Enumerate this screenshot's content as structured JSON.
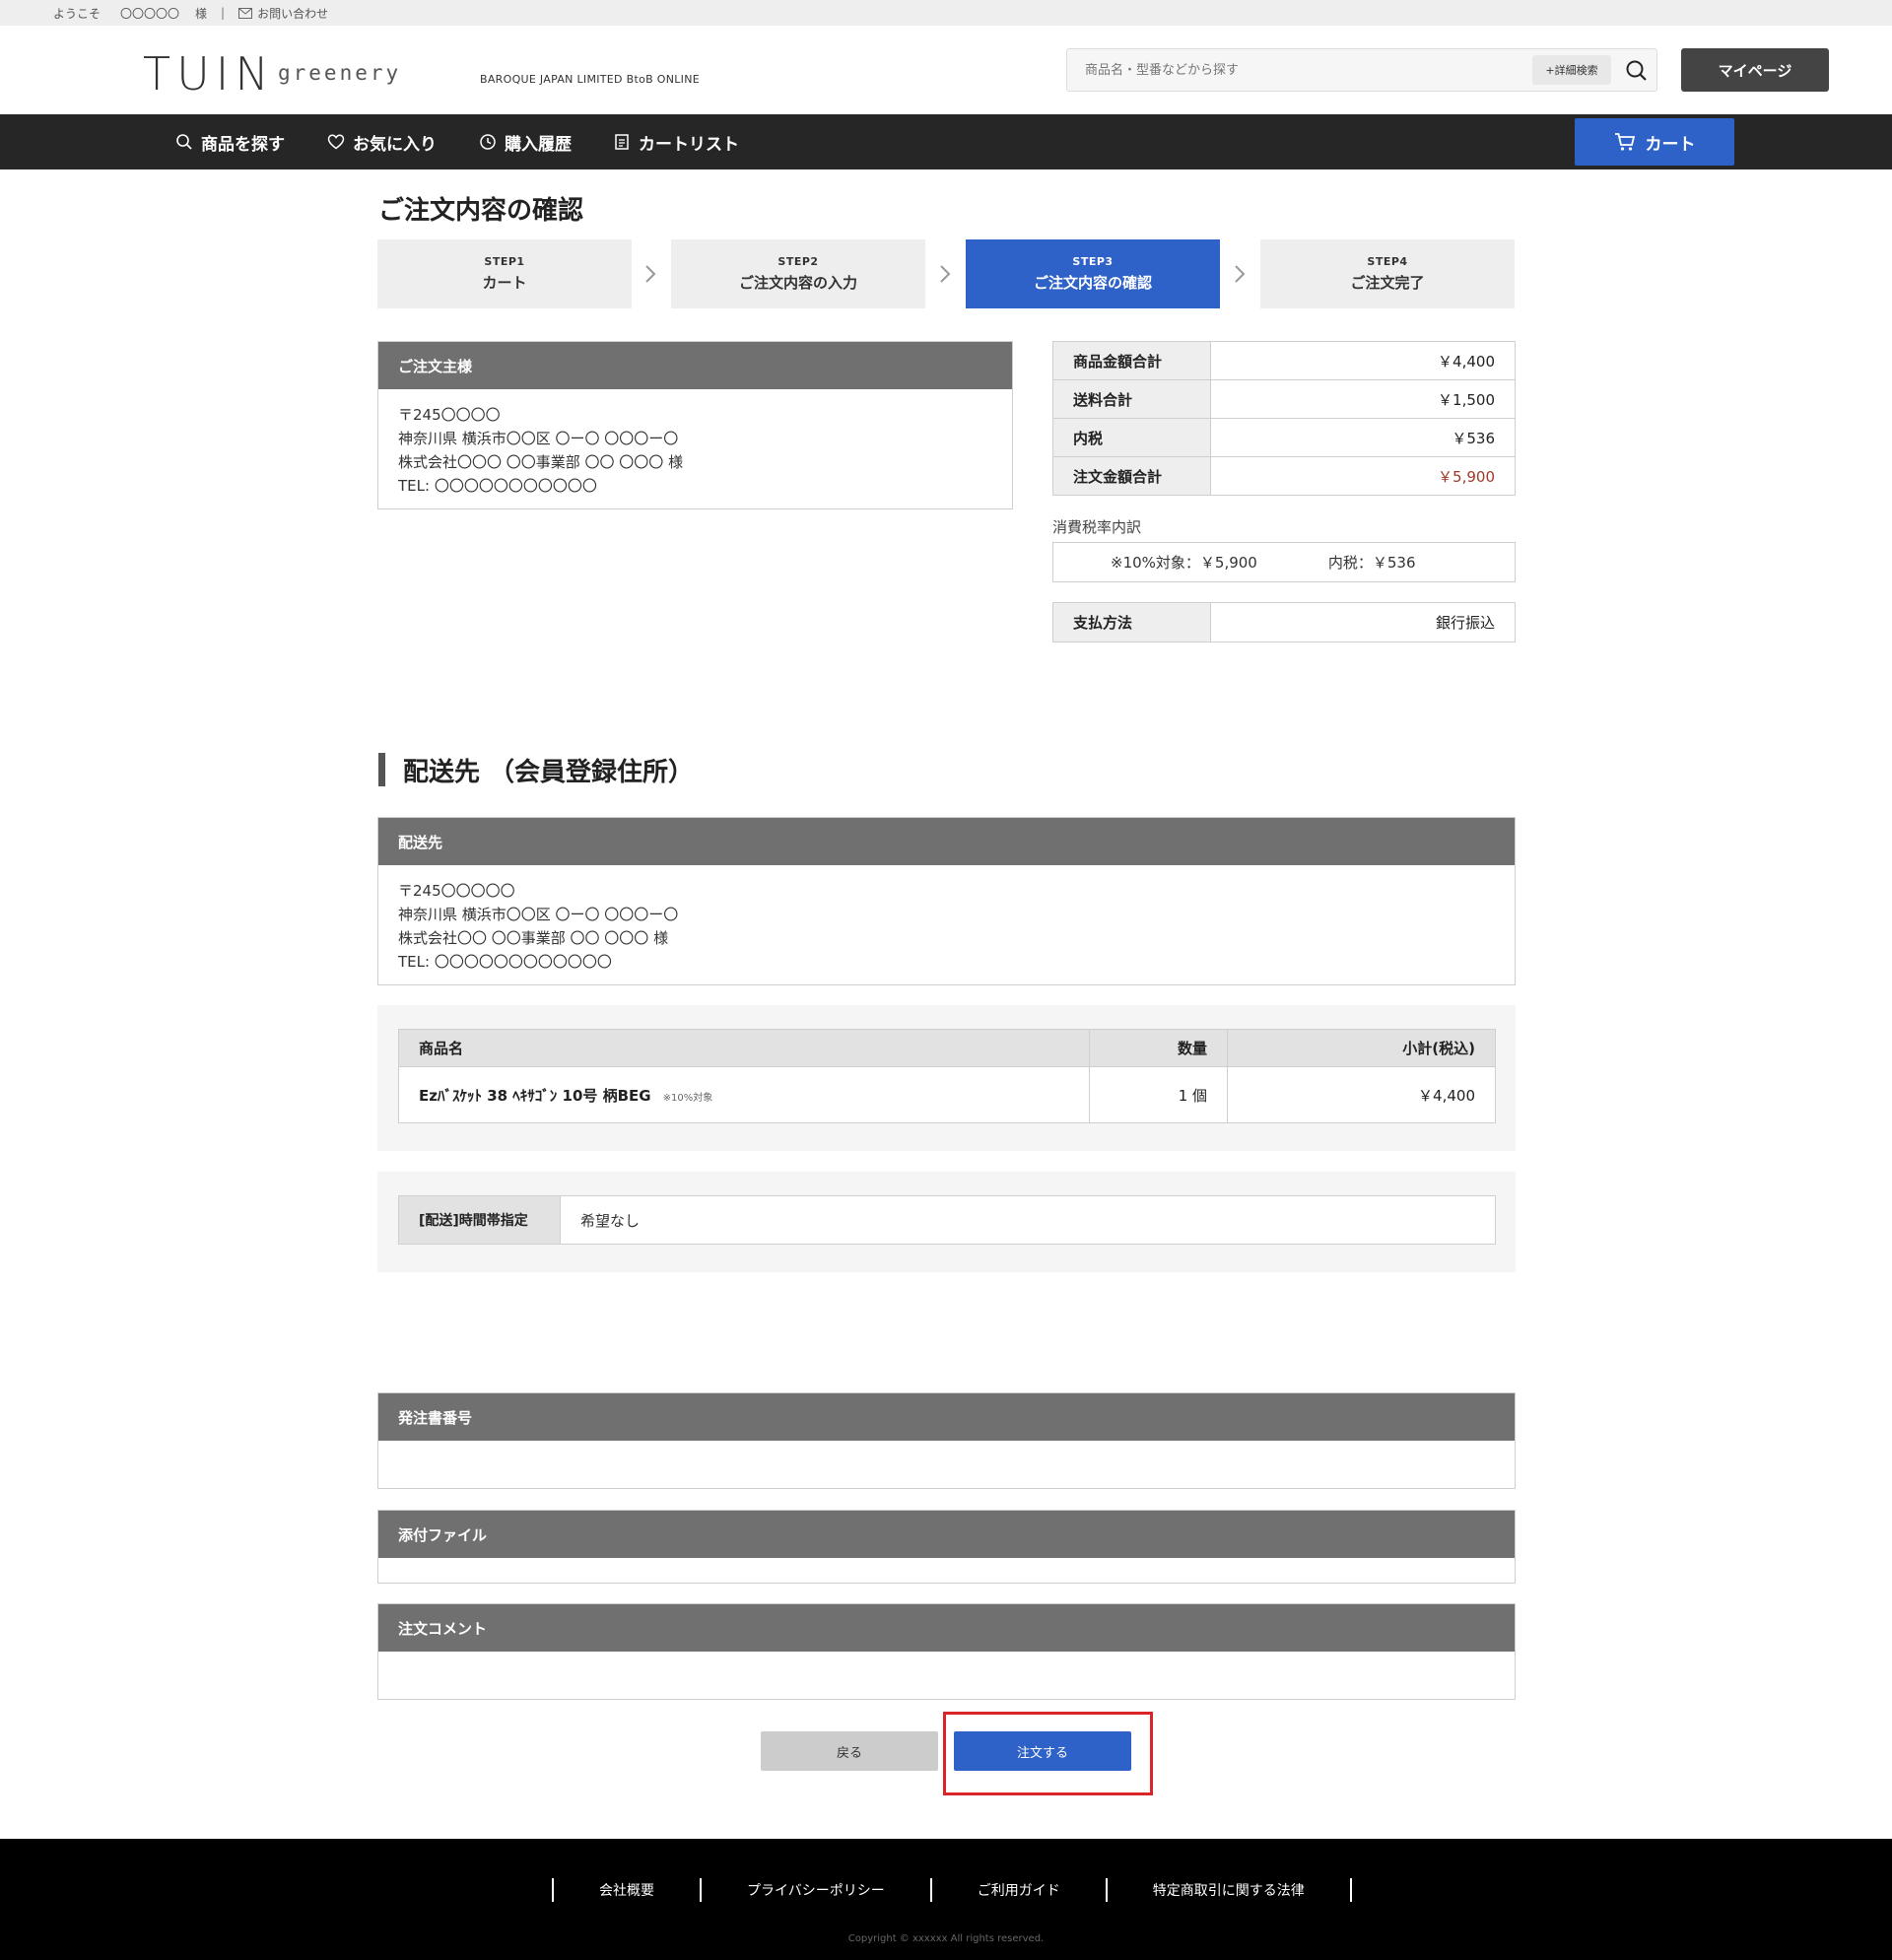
{
  "util": {
    "welcome": "ようこそ",
    "user": "〇〇〇〇〇",
    "honorific": "様",
    "separator": "|",
    "contact": "お問い合わせ"
  },
  "header": {
    "logo_main": "TUIN",
    "logo_sub": "greenery",
    "tagline": "BAROQUE JAPAN LIMITED BtoB ONLINE",
    "search_placeholder": "商品名・型番などから探す",
    "advanced_search": "+詳細検索",
    "mypage": "マイページ"
  },
  "nav": {
    "items": [
      {
        "label": "商品を探す",
        "icon": "search-icon"
      },
      {
        "label": "お気に入り",
        "icon": "heart-icon"
      },
      {
        "label": "購入履歴",
        "icon": "history-icon"
      },
      {
        "label": "カートリスト",
        "icon": "list-icon"
      }
    ],
    "cart": "カート"
  },
  "page": {
    "title": "ご注文内容の確認"
  },
  "steps": [
    {
      "num": "STEP1",
      "label": "カート",
      "active": false
    },
    {
      "num": "STEP2",
      "label": "ご注文内容の入力",
      "active": false
    },
    {
      "num": "STEP3",
      "label": "ご注文内容の確認",
      "active": true
    },
    {
      "num": "STEP4",
      "label": "ご注文完了",
      "active": false
    }
  ],
  "orderer": {
    "heading": "ご注文主様",
    "lines": [
      "〒245〇〇〇〇",
      "神奈川県 横浜市〇〇区 〇ー〇 〇〇〇ー〇",
      "株式会社〇〇〇 〇〇事業部 〇〇 〇〇〇  様",
      "TEL: 〇〇〇〇〇〇〇〇〇〇〇"
    ]
  },
  "summary": {
    "rows": [
      {
        "label": "商品金額合計",
        "value": "￥4,400"
      },
      {
        "label": "送料合計",
        "value": "￥1,500"
      },
      {
        "label": "内税",
        "value": "￥536"
      },
      {
        "label": "注文金額合計",
        "value": "￥5,900"
      }
    ],
    "tax_breakdown_label": "消費税率内訳",
    "tax_target": "※10%対象：￥5,900",
    "tax_included": "内税：￥536",
    "payment_label": "支払方法",
    "payment_value": "銀行振込"
  },
  "shipping": {
    "section_title": "配送先 （会員登録住所）",
    "heading": "配送先",
    "lines": [
      "〒245〇〇〇〇〇",
      "神奈川県 横浜市〇〇区 〇ー〇 〇〇〇ー〇",
      "株式会社〇〇 〇〇事業部 〇〇 〇〇〇 様",
      "TEL: 〇〇〇〇〇〇〇〇〇〇〇〇"
    ]
  },
  "items_table": {
    "headers": {
      "name": "商品名",
      "qty": "数量",
      "subtotal": "小計(税込)"
    },
    "rows": [
      {
        "name": "Ezﾊﾞｽｹｯﾄ 38 ﾍｷｻｺﾞﾝ 10号 柄BEG",
        "note": "※10%対象",
        "qty": "1 個",
        "subtotal": "￥4,400"
      }
    ]
  },
  "delivery_time": {
    "label": "[配送]時間帯指定",
    "value": "希望なし"
  },
  "extra": {
    "po_number": "発注書番号",
    "attachment": "添付ファイル",
    "comment": "注文コメント"
  },
  "buttons": {
    "back": "戻る",
    "order": "注文する"
  },
  "footer": {
    "links": [
      "会社概要",
      "プライバシーポリシー",
      "ご利用ガイド",
      "特定商取引に関する法律"
    ],
    "copyright": "Copyright © xxxxxx All rights reserved."
  },
  "colors": {
    "accent": "#2f62c8",
    "nav_bg": "#262626",
    "panel_head": "#707070",
    "total_red": "#a0392a",
    "highlight": "#d9252a"
  }
}
